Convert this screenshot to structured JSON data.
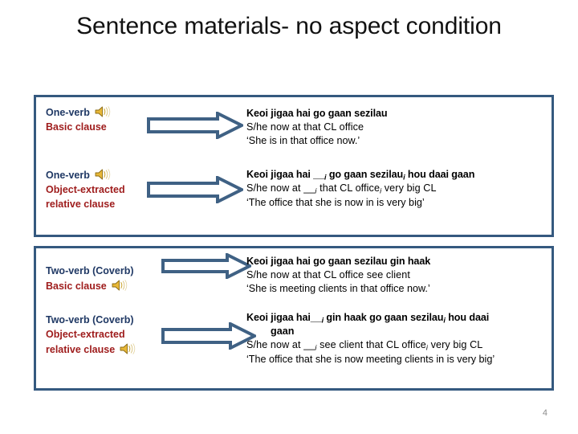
{
  "slide": {
    "title": "Sentence materials- no aspect condition",
    "page_number": "4"
  },
  "colors": {
    "box_border": "#35597F",
    "arrow_stroke": "#3F6184",
    "label_blue": "#1F3864",
    "label_red": "#9E1B1B",
    "page_number": "#8C8C8C",
    "speaker_icon": "#D9A515"
  },
  "rows": [
    {
      "id": "one-verb-basic",
      "label_blue": "One-verb",
      "label_red": "Basic clause",
      "speaker_after": "blue",
      "arrow_name": "block-arrow-right",
      "sentence_bold": "Keoi jigaa hai go gaan sezilau",
      "sentence_gloss": "S/he  now  at  that CL    office",
      "sentence_translation": "‘She is in that office now.’"
    },
    {
      "id": "one-verb-object-extracted",
      "label_blue": "One-verb",
      "label_red": "Object-extracted relative clause",
      "label_red_line1": "Object-extracted",
      "label_red_line2": "relative clause",
      "speaker_after": "blue",
      "arrow_name": "block-arrow-right",
      "sentence_bold_pre": "Keoi jigaa  hai __",
      "sentence_bold_sub1": "i",
      "sentence_bold_mid": "  go gaan sezilau",
      "sentence_bold_sub2": "i",
      "sentence_bold_post": " hou daai gaan",
      "sentence_gloss_pre": "S/he now      at   __",
      "sentence_gloss_sub1": "i",
      "sentence_gloss_mid": "   that CL office",
      "sentence_gloss_sub2": "i",
      "sentence_gloss_post": "        very  big  CL",
      "sentence_translation": "‘The office that she is now in is very big’"
    },
    {
      "id": "two-verb-basic",
      "label_blue": "Two-verb (Coverb)",
      "label_red": "Basic clause",
      "speaker_after": "red",
      "arrow_name": "block-arrow-right",
      "sentence_bold": "Keoi jigaa hai go gaan sezilau gin haak",
      "sentence_gloss": "S/he now      at that CL     office    see client",
      "sentence_translation": "‘She is meeting clients in that office now.’"
    },
    {
      "id": "two-verb-object-extracted",
      "label_blue": "Two-verb (Coverb)",
      "label_red_line1": "Object-extracted",
      "label_red_line2": "relative clause",
      "speaker_after": "red2",
      "arrow_name": "block-arrow-right",
      "sentence_bold_pre": "Keoi jigaa hai__",
      "sentence_bold_sub1": "i",
      "sentence_bold_mid": " gin haak go gaan sezilau",
      "sentence_bold_sub2": "i",
      "sentence_bold_post": " hou daai",
      "sentence_bold_line2": "gaan",
      "sentence_gloss_pre": "S/he now  at  __",
      "sentence_gloss_sub1": "i",
      "sentence_gloss_mid": " see client that CL office",
      "sentence_gloss_sub2": "i",
      "sentence_gloss_post": "  very  big  CL",
      "sentence_translation": "‘The office that she is now meeting clients in is very big’"
    }
  ],
  "icons": {
    "speaker": "speaker-icon",
    "arrow": "arrow-right-icon"
  }
}
